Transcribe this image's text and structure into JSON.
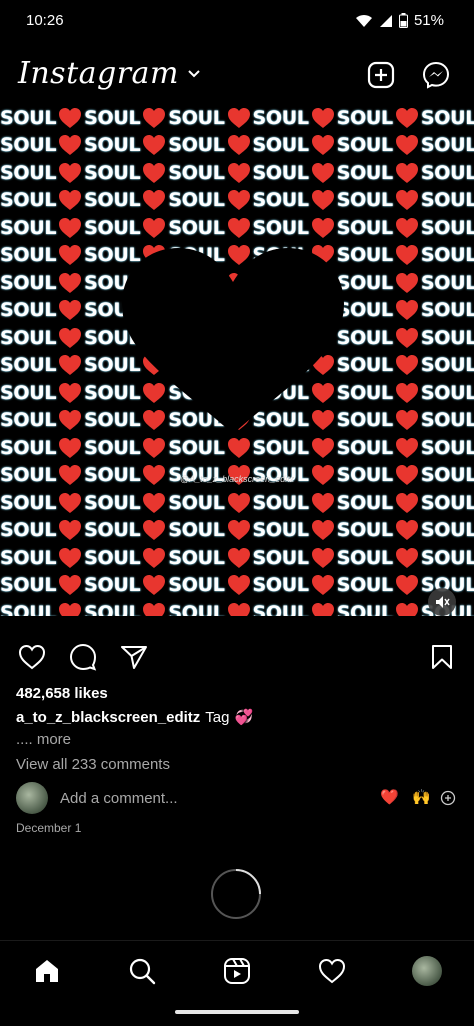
{
  "status_bar": {
    "time": "10:26",
    "battery": "51%"
  },
  "header": {
    "brand": "Instagram"
  },
  "post": {
    "pattern_word": "SOUL",
    "watermark": "@A_to_z_blackscreen_editz",
    "likes": "482,658 likes",
    "caption_user": "a_to_z_blackscreen_editz",
    "caption_text": "Tag",
    "caption_emoji": "💞",
    "more": ".... more",
    "view_comments": "View all 233 comments",
    "add_comment_placeholder": "Add a comment...",
    "quick_reactions": [
      "❤️",
      "🙌"
    ],
    "date": "December 1"
  },
  "colors": {
    "accent_heart": "#e8362f",
    "muted_text": "#a8a8a8",
    "glow": "#8fe3ff"
  },
  "icons": [
    "heart-icon",
    "comment-icon",
    "share-icon",
    "bookmark-icon",
    "add-post-icon",
    "messenger-icon",
    "home-icon",
    "search-icon",
    "reels-icon",
    "activity-icon"
  ]
}
